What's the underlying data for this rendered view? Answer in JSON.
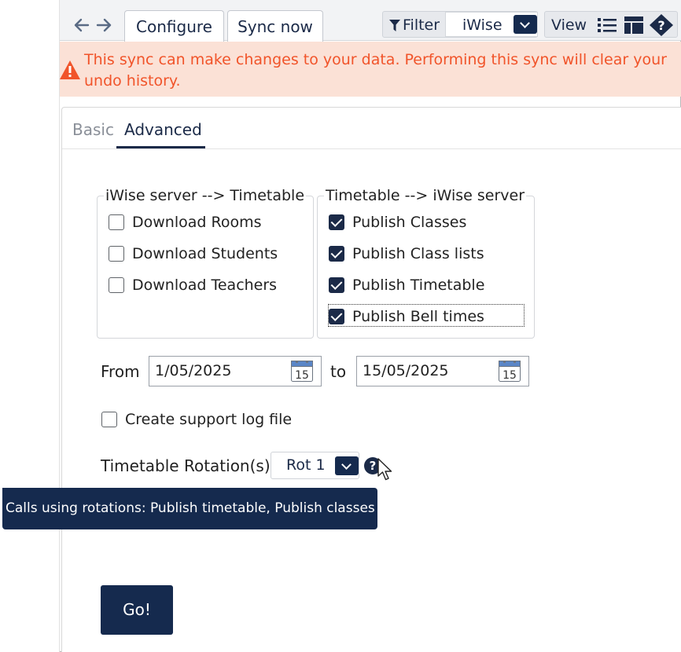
{
  "toolbar": {
    "back_icon": "arrow-left-icon",
    "forward_icon": "arrow-right-icon",
    "tabs": [
      {
        "label": "Configure"
      },
      {
        "label": "Sync now"
      }
    ],
    "filter_label": "Filter",
    "filter_icon": "funnel-icon",
    "filter_value": "iWise",
    "view_label": "View",
    "view_icons": [
      "list-icon",
      "layout-icon",
      "help-diamond-icon"
    ]
  },
  "warning": {
    "icon": "warning-triangle-icon",
    "text": "This sync can make changes to your data. Performing this sync will clear your undo history.",
    "color": "#f1542a",
    "background": "#fbe1d6"
  },
  "subtabs": {
    "basic": "Basic",
    "advanced": "Advanced",
    "active": "Advanced"
  },
  "download_group": {
    "legend": "iWise server --> Timetable",
    "items": [
      {
        "label": "Download Rooms",
        "checked": false
      },
      {
        "label": "Download Students",
        "checked": false
      },
      {
        "label": "Download Teachers",
        "checked": false
      }
    ]
  },
  "publish_group": {
    "legend": "Timetable --> iWise server",
    "items": [
      {
        "label": "Publish Classes",
        "checked": true
      },
      {
        "label": "Publish Class lists",
        "checked": true
      },
      {
        "label": "Publish Timetable",
        "checked": true
      },
      {
        "label": "Publish Bell times",
        "checked": true
      }
    ]
  },
  "date_range": {
    "from_label": "From",
    "from_value": "1/05/2025",
    "to_label": "to",
    "to_value": "15/05/2025",
    "calendar_day": "15"
  },
  "support_log": {
    "label": "Create support log file",
    "checked": false
  },
  "rotation": {
    "label": "Timetable Rotation(s)",
    "value": "Rot 1",
    "help_glyph": "?"
  },
  "tooltip": {
    "text": "Calls using rotations: Publish timetable, Publish classes"
  },
  "go_button": {
    "label": "Go!"
  },
  "colors": {
    "navy": "#152a4e",
    "accent_text": "#1b2a48"
  }
}
